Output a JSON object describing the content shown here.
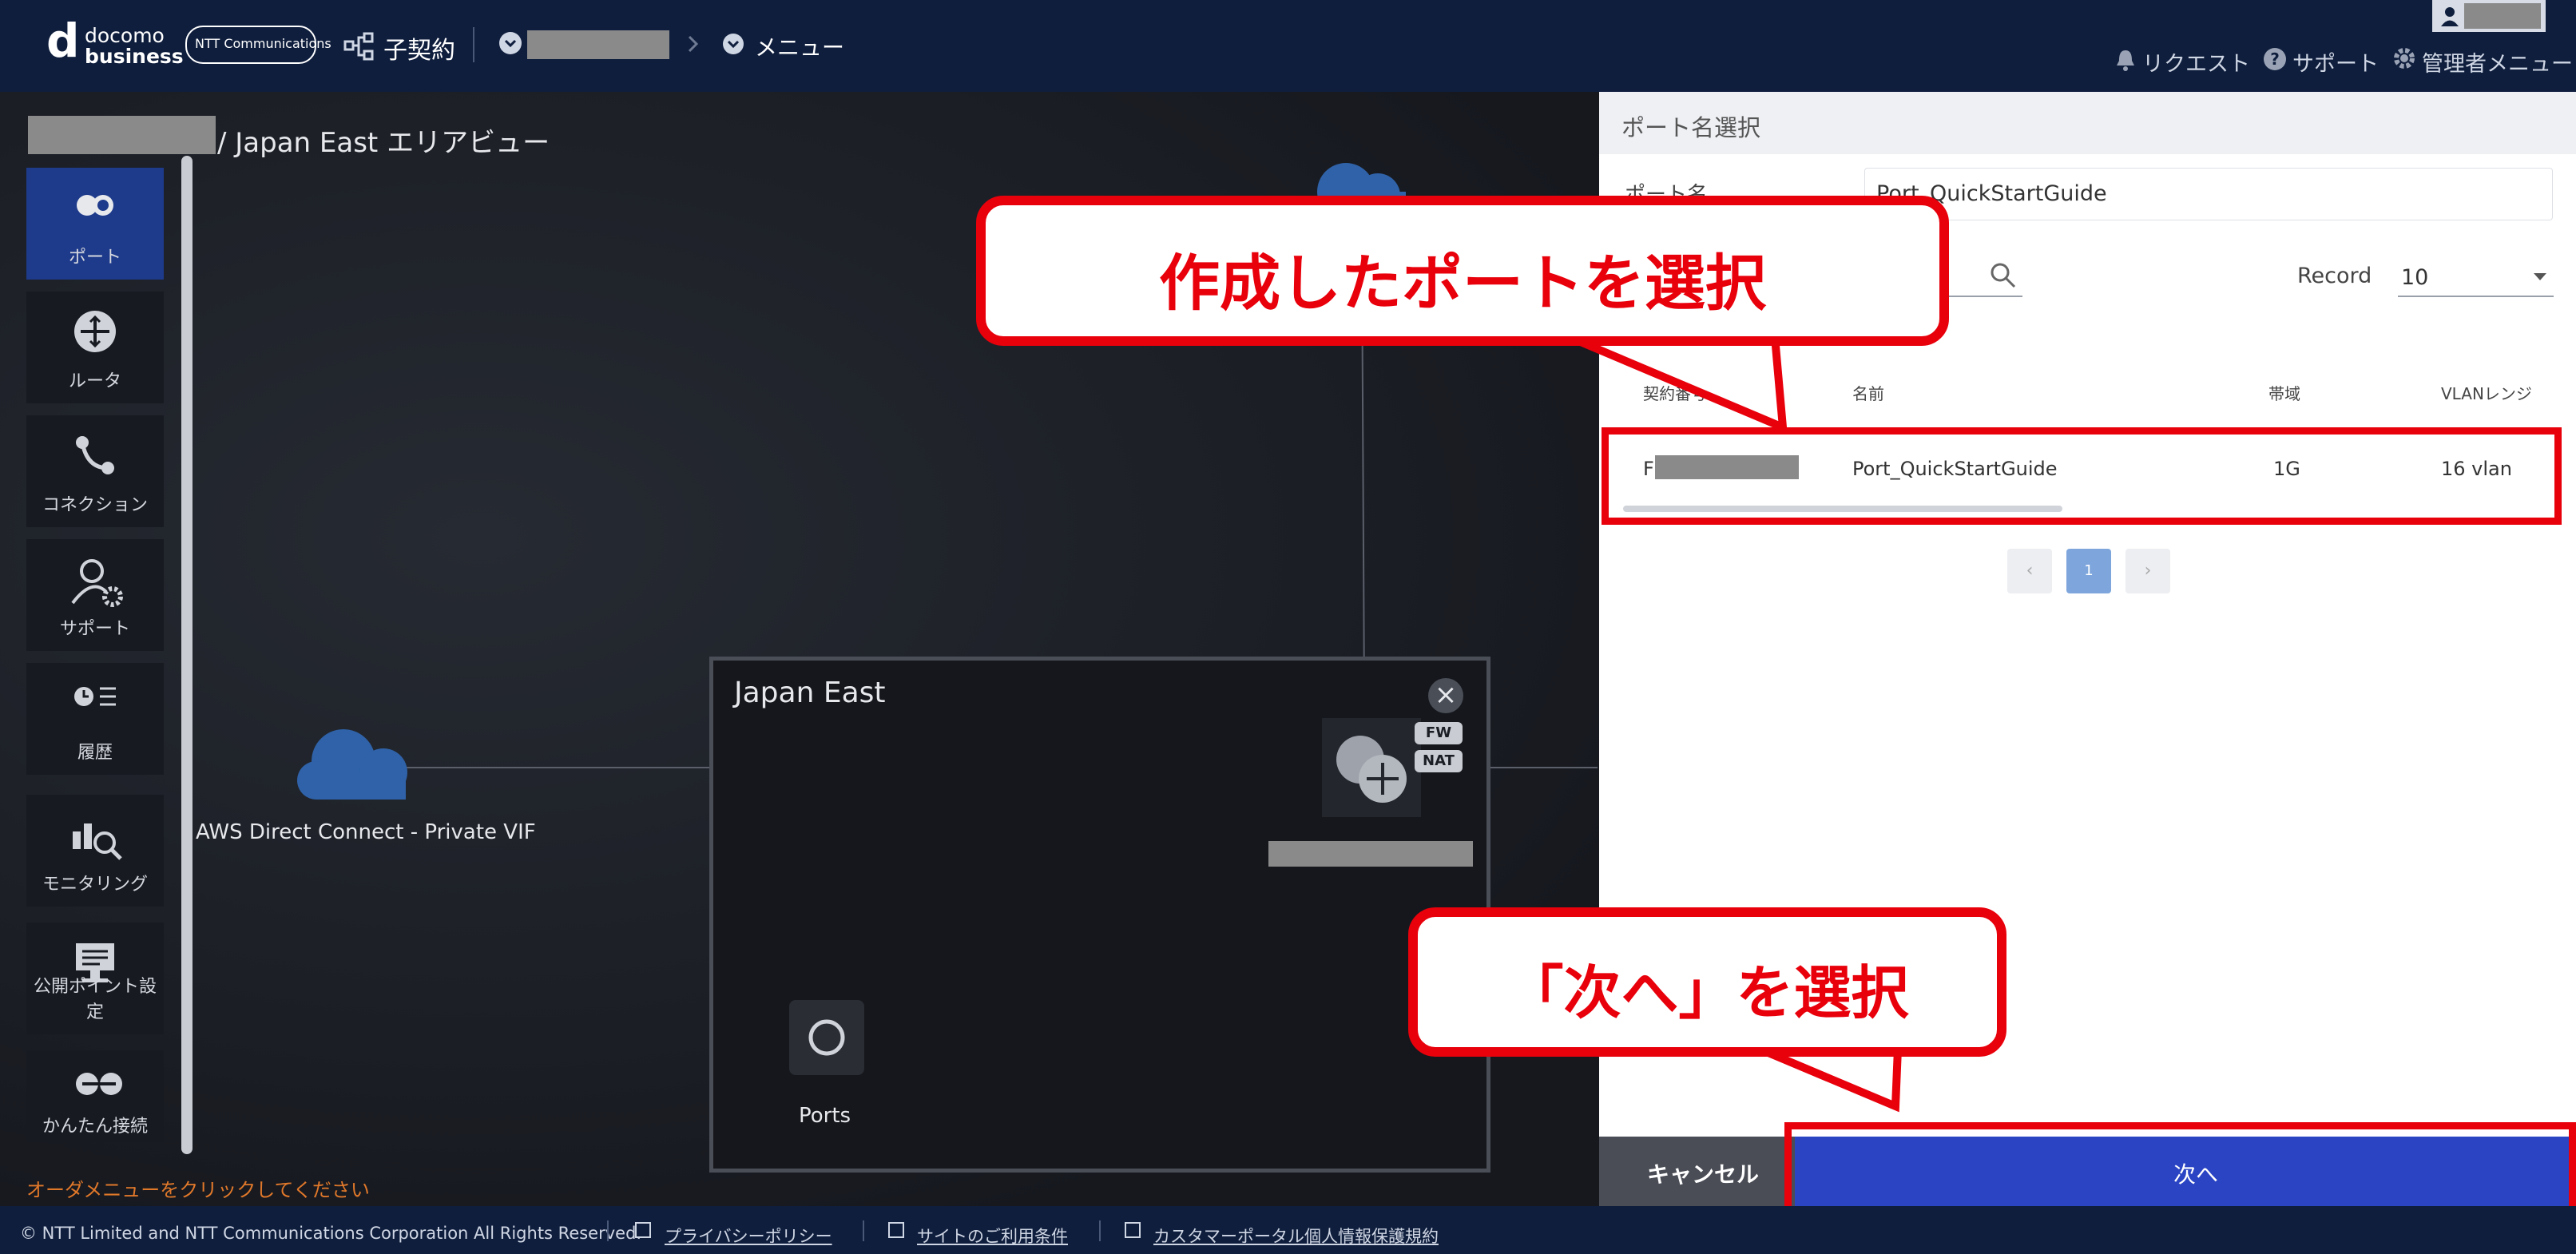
{
  "header": {
    "logo_line1": "docomo",
    "logo_line2": "business",
    "ntt": "NTT Communications",
    "contract": "子契約",
    "menu": "メニュー",
    "nav_request": "リクエスト",
    "nav_support": "サポート",
    "nav_admin": "管理者メニュー"
  },
  "map": {
    "breadcrumb_suffix": "/ Japan East エリアビュー",
    "region_title": "Japan East",
    "cloud_label": "AWS Direct Connect - Private VIF",
    "ports_label": "Ports",
    "fw_tag": "FW",
    "nat_tag": "NAT",
    "order_hint": "オーダメニューをクリックしてください"
  },
  "sidebar": [
    {
      "label": "ポート",
      "icon": "port-icon",
      "active": true
    },
    {
      "label": "ルータ",
      "icon": "router-icon"
    },
    {
      "label": "コネクション",
      "icon": "connection-icon"
    },
    {
      "label": "サポート",
      "icon": "support-icon"
    },
    {
      "label": "履歴",
      "icon": "history-icon"
    },
    {
      "label": "モニタリング",
      "icon": "monitoring-icon"
    },
    {
      "label": "公開ポイント設定",
      "icon": "publish-point-icon"
    },
    {
      "label": "かんたん接続",
      "icon": "easy-connect-icon"
    }
  ],
  "panel": {
    "title": "ポート名選択",
    "field_label": "ポート名",
    "field_value": "Port_QuickStartGuide",
    "record_label": "Record",
    "record_value": "10",
    "columns": [
      "契約番号",
      "名前",
      "帯域",
      "VLANレンジ"
    ],
    "rows": [
      {
        "contract": "F",
        "name": "Port_QuickStartGuide",
        "bandwidth": "1G",
        "vlan": "16 vlan"
      }
    ],
    "page_prev": "‹",
    "page_current": "1",
    "page_next": "›",
    "cancel_label": "キャンセル",
    "next_label": "次へ"
  },
  "callouts": {
    "select_port": "作成したポートを選択",
    "select_next": "「次へ」を選択"
  },
  "footer": {
    "copyright": "© NTT Limited and NTT Communications Corporation All Rights Reserved.",
    "privacy": "プライバシーポリシー",
    "terms": "サイトのご利用条件",
    "personal": "カスタマーポータル個人情報保護規約"
  },
  "colors": {
    "header_bg": "#0f1e3d",
    "accent_blue": "#2a44c4",
    "callout_red": "#e8000b",
    "sidebar_active": "#1e3a8a"
  }
}
